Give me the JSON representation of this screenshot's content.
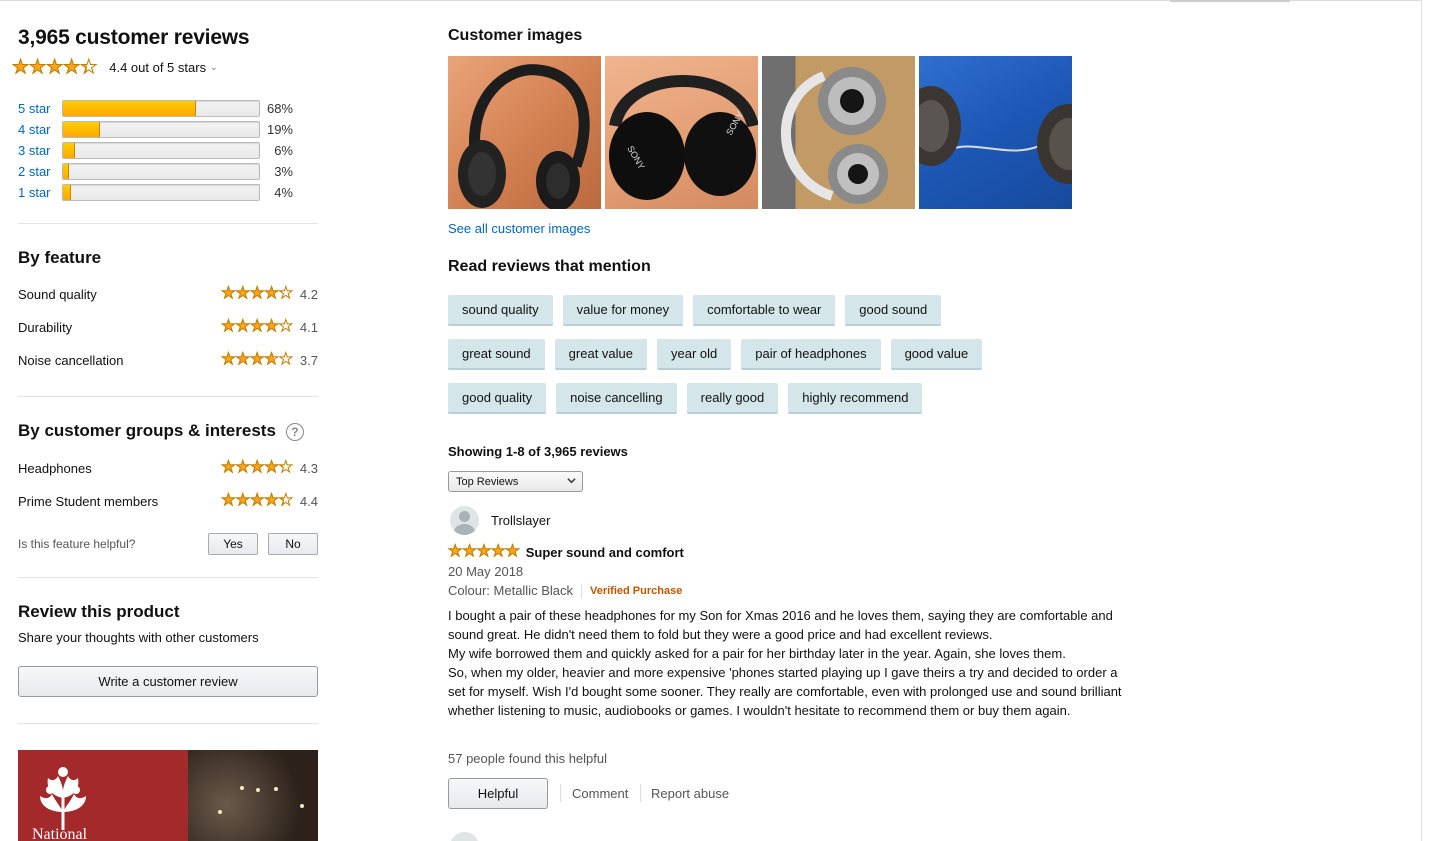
{
  "summary": {
    "total_title": "3,965 customer reviews",
    "rating_text": "4.4 out of 5 stars",
    "rating": 4.4,
    "histogram": [
      {
        "label": "5 star",
        "pct_text": "68%",
        "pct": 68
      },
      {
        "label": "4 star",
        "pct_text": "19%",
        "pct": 19
      },
      {
        "label": "3 star",
        "pct_text": "6%",
        "pct": 6
      },
      {
        "label": "2 star",
        "pct_text": "3%",
        "pct": 3
      },
      {
        "label": "1 star",
        "pct_text": "4%",
        "pct": 4
      }
    ]
  },
  "by_feature": {
    "title": "By feature",
    "items": [
      {
        "name": "Sound quality",
        "value": "4.2",
        "rating": 4.2
      },
      {
        "name": "Durability",
        "value": "4.1",
        "rating": 4.1
      },
      {
        "name": "Noise cancellation",
        "value": "3.7",
        "rating": 3.7
      }
    ]
  },
  "by_groups": {
    "title": "By customer groups & interests",
    "help_glyph": "?",
    "items": [
      {
        "name": "Headphones",
        "value": "4.3",
        "rating": 4.3
      },
      {
        "name": "Prime Student members",
        "value": "4.4",
        "rating": 4.4
      }
    ],
    "helpful_question": "Is this feature helpful?",
    "yes_label": "Yes",
    "no_label": "No"
  },
  "review_product": {
    "title": "Review this product",
    "subtitle": "Share your thoughts with other customers",
    "button_label": "Write a customer review"
  },
  "ad": {
    "brand": "National"
  },
  "customer_images": {
    "title": "Customer images",
    "see_all": "See all customer images"
  },
  "mentions": {
    "title": "Read reviews that mention",
    "rows": [
      [
        "sound quality",
        "value for money",
        "comfortable to wear",
        "good sound"
      ],
      [
        "great sound",
        "great value",
        "year old",
        "pair of headphones",
        "good value"
      ],
      [
        "good quality",
        "noise cancelling",
        "really good",
        "highly recommend"
      ]
    ]
  },
  "list": {
    "showing": "Showing 1-8 of 3,965 reviews",
    "sort_selected": "Top Reviews"
  },
  "review": {
    "author": "Trollslayer",
    "rating": 5,
    "title": "Super sound and comfort",
    "date": "20 May 2018",
    "variant": "Colour: Metallic Black",
    "verified": "Verified Purchase",
    "body": [
      "I bought a pair of these headphones for my Son for Xmas 2016 and he loves them, saying they are comfortable and sound great. He didn't need them to fold but they were a good price and had excellent reviews.",
      "My wife borrowed them and quickly asked for a pair for her birthday later in the year. Again, she loves them.",
      "So, when my older, heavier and more expensive 'phones started playing up I gave theirs a try and decided to order a set for myself. Wish I'd bought some sooner. They really are comfortable, even with prolonged use and sound brilliant whether listening to music, audiobooks or games. I wouldn't hesitate to recommend them or buy them again."
    ],
    "helpful_count": "57 people found this helpful",
    "helpful_button": "Helpful",
    "comment": "Comment",
    "report": "Report abuse"
  },
  "colors": {
    "link": "#0066c0",
    "star": "#ffa41c",
    "bar": "#ffa700",
    "chip": "#d5e6ea",
    "verified": "#c45500"
  }
}
